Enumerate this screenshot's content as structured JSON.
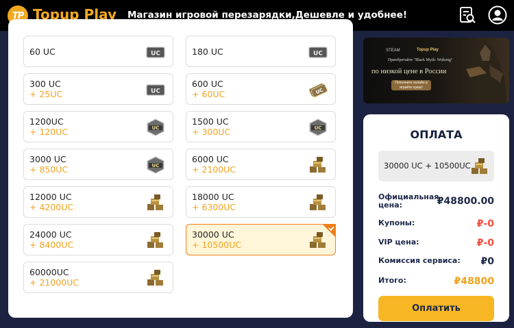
{
  "header": {
    "logo_badge": "TP",
    "logo_text": "Topup Play",
    "slogan": "Магазин игровой перезарядки,Дешевле и удобнее!",
    "icons": [
      "orders-search-icon",
      "account-icon"
    ],
    "brand_color": "#f2a81d"
  },
  "products": [
    {
      "amount": "60 UC",
      "bonus": "",
      "icon": "uc-card-icon",
      "selected": false
    },
    {
      "amount": "180 UC",
      "bonus": "",
      "icon": "uc-card-icon",
      "selected": false
    },
    {
      "amount": "300 UC",
      "bonus": "+ 25UC",
      "icon": "uc-card-icon",
      "selected": false
    },
    {
      "amount": "600 UC",
      "bonus": "+ 60UC",
      "icon": "uc-cards-stack-icon",
      "selected": false
    },
    {
      "amount": "1200UC",
      "bonus": "+ 120UC",
      "icon": "uc-badge-icon",
      "selected": false
    },
    {
      "amount": "1500 UC",
      "bonus": "+ 300UC",
      "icon": "uc-badge-icon",
      "selected": false
    },
    {
      "amount": "3000 UC",
      "bonus": "+ 850UC",
      "icon": "uc-badge-icon",
      "selected": false
    },
    {
      "amount": "6000 UC",
      "bonus": "+ 2100UC",
      "icon": "uc-pile-icon",
      "selected": false
    },
    {
      "amount": "12000 UC",
      "bonus": "+ 4200UC",
      "icon": "uc-pile-icon",
      "selected": false
    },
    {
      "amount": "18000 UC",
      "bonus": "+ 6300UC",
      "icon": "uc-pile-icon",
      "selected": false
    },
    {
      "amount": "24000 UC",
      "bonus": "+ 8400UC",
      "icon": "uc-pile-icon",
      "selected": false
    },
    {
      "amount": "30000 UC",
      "bonus": "+ 10500UC",
      "icon": "uc-pile-icon",
      "selected": true
    },
    {
      "amount": "60000UC",
      "bonus": "+ 21000UC",
      "icon": "uc-pile-icon",
      "selected": false
    }
  ],
  "banner": {
    "steam": "STEAM",
    "brand": "Topup Play",
    "line1": "Приобретайте \"Black Myth: Wukong\"",
    "line2": "по низкой цене в России",
    "button": "Пополните онлайн и играйте сразу!"
  },
  "payment": {
    "title": "ОПЛАТА",
    "selected_item": "30000 UC + 10500UC",
    "rows": [
      {
        "label": "Официальная цена:",
        "value": "₽48800.00",
        "color": "#1d2848"
      },
      {
        "label": "Купоны:",
        "value": "₽-0",
        "color": "#f04e3e"
      },
      {
        "label": "VIP цена:",
        "value": "₽-0",
        "color": "#f04e3e"
      },
      {
        "label": "Комиссия сервиса:",
        "value": "₽0",
        "color": "#1d2848"
      },
      {
        "label": "Итого:",
        "value": "₽48800",
        "color": "#f2a21d"
      }
    ],
    "button": "Оплатить",
    "button_color": "#f7b623"
  }
}
